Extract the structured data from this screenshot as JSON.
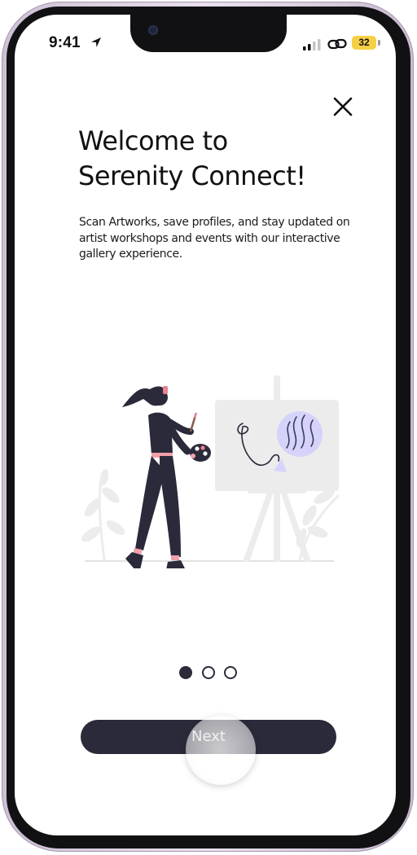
{
  "status_bar": {
    "time": "9:41",
    "battery": "32",
    "icons": [
      "location-arrow-icon",
      "signal-icon",
      "link-icon",
      "battery-icon"
    ]
  },
  "onboarding": {
    "close_icon": "close-icon",
    "title_line1": "Welcome to",
    "title_line2": "Serenity Connect!",
    "description": "Scan Artworks, save profiles, and stay updated on artist workshops and events with our interactive gallery experience.",
    "illustration": "artist-painting-illustration",
    "pagination": {
      "total": 3,
      "active": 1
    },
    "next_label": "Next"
  },
  "colors": {
    "primary": "#2b2a3a",
    "accent": "#c9c5f5",
    "battery": "#f5cf45",
    "text": "#111111"
  }
}
